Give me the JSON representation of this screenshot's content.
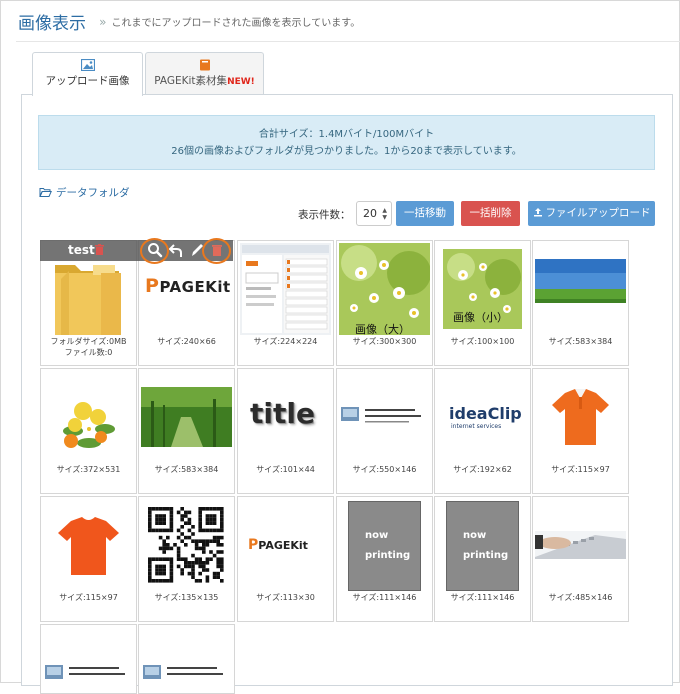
{
  "header": {
    "title": "画像表示",
    "separator": "»",
    "subtitle": "これまでにアップロードされた画像を表示しています。"
  },
  "tabs": [
    {
      "label": "アップロード画像",
      "active": true
    },
    {
      "label": "PAGEKit素材集",
      "badge": "NEW!",
      "active": false
    }
  ],
  "info": {
    "line1": "合計サイズ：1.4Mバイト/100Mバイト",
    "line2": "26個の画像およびフォルダが見つかりました。1から20まで表示しています。"
  },
  "folder_link": "データフォルダ",
  "toolbar": {
    "per_page_label": "表示件数：",
    "per_page_value": "20",
    "move_label": "一括移動",
    "delete_label": "一括削除",
    "upload_label": "ファイルアップロード"
  },
  "overlay": {
    "folder_name": "test"
  },
  "grid": [
    {
      "caption": "フォルダサイズ:0MB",
      "caption2": "ファイル数:0",
      "thumb": "folder"
    },
    {
      "caption": "サイズ:240×66",
      "thumb": "pagekit-logo",
      "logo_text": "PAGEKit"
    },
    {
      "caption": "サイズ:224×224",
      "thumb": "screenshot"
    },
    {
      "caption": "サイズ:300×300",
      "thumb": "flowers",
      "label": "画像（大）"
    },
    {
      "caption": "サイズ:100×100",
      "thumb": "flowers",
      "label": "画像（小）"
    },
    {
      "caption": "サイズ:583×384",
      "thumb": "landscape"
    },
    {
      "caption": "サイズ:372×531",
      "thumb": "bouquet"
    },
    {
      "caption": "サイズ:583×384",
      "thumb": "forest"
    },
    {
      "caption": "サイズ:101×44",
      "thumb": "title-text",
      "logo_text": "title"
    },
    {
      "caption": "サイズ:550×146",
      "thumb": "banner"
    },
    {
      "caption": "サイズ:192×62",
      "thumb": "ideaclip",
      "logo_text": "ideaClip",
      "logo_sub": "internet services"
    },
    {
      "caption": "サイズ:115×97",
      "thumb": "polo"
    },
    {
      "caption": "サイズ:115×97",
      "thumb": "tshirt"
    },
    {
      "caption": "サイズ:135×135",
      "thumb": "qr"
    },
    {
      "caption": "サイズ:113×30",
      "thumb": "pagekit-logo",
      "logo_text": "PAGEKit"
    },
    {
      "caption": "サイズ:111×146",
      "thumb": "nowprinting",
      "line1": "now",
      "line2": "printing"
    },
    {
      "caption": "サイズ:111×146",
      "thumb": "nowprinting",
      "line1": "now",
      "line2": "printing"
    },
    {
      "caption": "サイズ:485×146",
      "thumb": "keyboard"
    },
    {
      "caption": "",
      "thumb": "banner"
    },
    {
      "caption": "",
      "thumb": "banner"
    }
  ],
  "colors": {
    "accent_blue": "#5b9bd5",
    "danger_red": "#d9534f",
    "highlight_orange": "#e8781e",
    "new_badge": "#e0261b"
  }
}
